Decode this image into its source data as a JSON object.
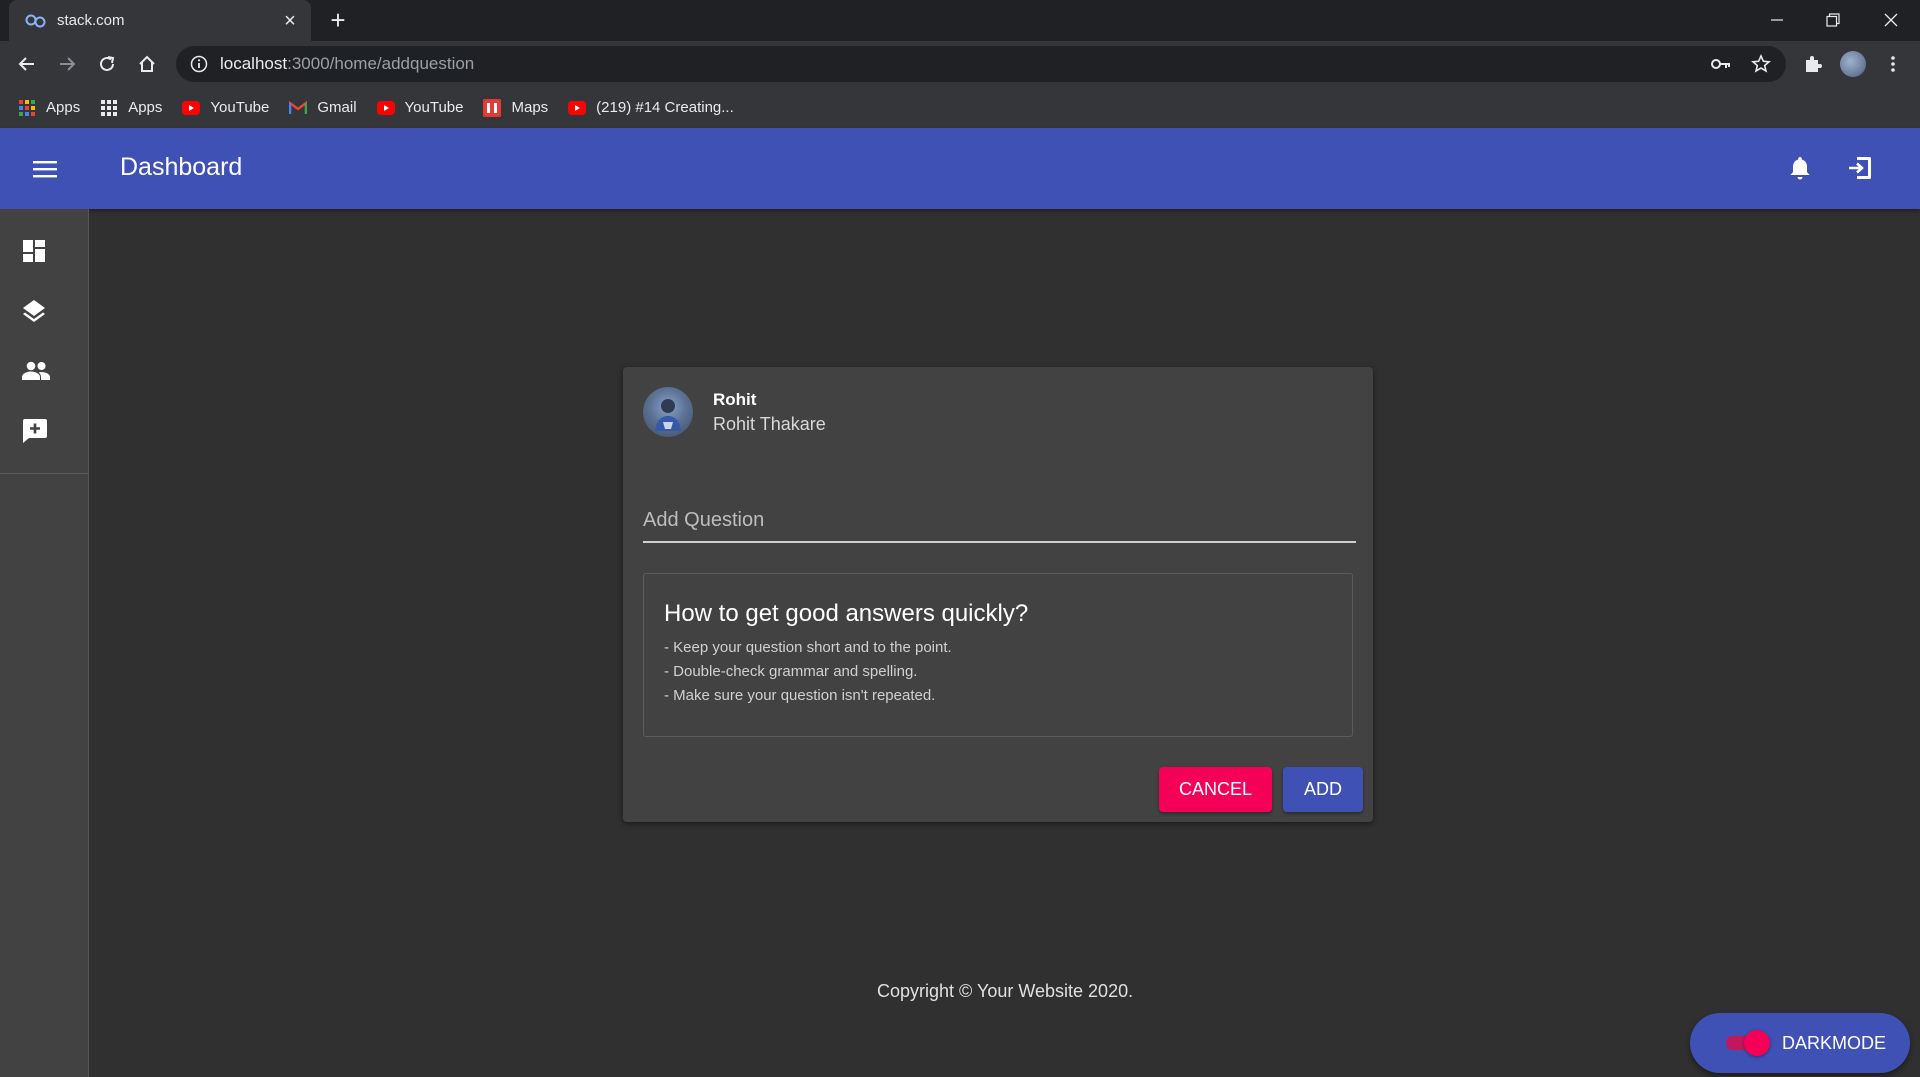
{
  "browser": {
    "tab_title": "stack.com",
    "url_host": "localhost",
    "url_path": ":3000/home/addquestion",
    "bookmarks": [
      {
        "label": "Apps",
        "icon": "apps-grid-color-icon"
      },
      {
        "label": "Apps",
        "icon": "apps-grid-icon"
      },
      {
        "label": "YouTube",
        "icon": "youtube-icon"
      },
      {
        "label": "Gmail",
        "icon": "gmail-icon"
      },
      {
        "label": "YouTube",
        "icon": "youtube-icon"
      },
      {
        "label": "Maps",
        "icon": "maps-icon"
      },
      {
        "label": "(219) #14 Creating...",
        "icon": "youtube-icon"
      }
    ]
  },
  "appbar": {
    "title": "Dashboard",
    "color": "#3f51b5"
  },
  "sidebar": {
    "items": [
      "dashboard-icon",
      "layers-icon",
      "people-icon",
      "add-comment-icon"
    ]
  },
  "card": {
    "username": "Rohit",
    "full_name": "Rohit Thakare",
    "question_placeholder": "Add Question",
    "question_value": "",
    "tips_title": "How to get good answers quickly?",
    "tips": [
      "- Keep your question short and to the point.",
      "- Double-check grammar and spelling.",
      "- Make sure your question isn't repeated."
    ],
    "cancel_label": "CANCEL",
    "add_label": "ADD",
    "cancel_color": "#f50057",
    "add_color": "#3f51b5"
  },
  "footer": {
    "copyright": "Copyright © Your Website 2020."
  },
  "darkmode": {
    "label": "DARKMODE",
    "enabled": true
  }
}
